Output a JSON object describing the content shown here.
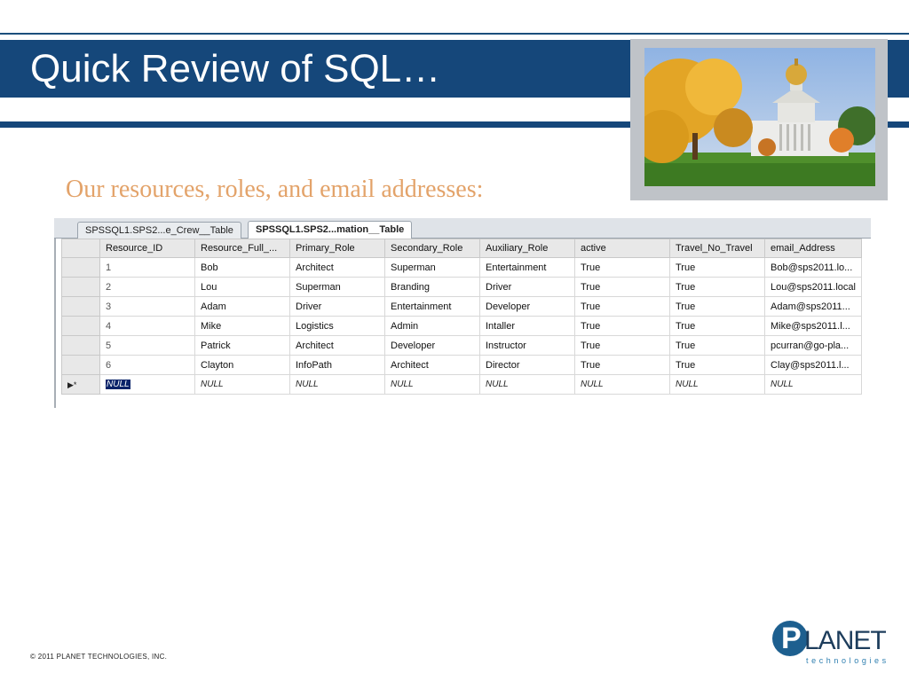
{
  "slide": {
    "title": "Quick Review of SQL…",
    "subtitle": "Our resources, roles, and email addresses:",
    "copyright": "©  2011  PLANET  TECHNOLOGIES,  INC."
  },
  "logo": {
    "letter": "P",
    "word": "LANET",
    "sub": "technologies"
  },
  "grid": {
    "tabs": [
      {
        "label": "SPSSQL1.SPS2...e_Crew__Table",
        "active": false
      },
      {
        "label": "SPSSQL1.SPS2...mation__Table",
        "active": true
      }
    ],
    "columns": [
      "Resource_ID",
      "Resource_Full_...",
      "Primary_Role",
      "Secondary_Role",
      "Auxiliary_Role",
      "active",
      "Travel_No_Travel",
      "email_Address"
    ],
    "rows": [
      [
        "1",
        "Bob",
        "Architect",
        "Superman",
        "Entertainment",
        "True",
        "True",
        "Bob@sps2011.lo..."
      ],
      [
        "2",
        "Lou",
        "Superman",
        "Branding",
        "Driver",
        "True",
        "True",
        "Lou@sps2011.local"
      ],
      [
        "3",
        "Adam",
        "Driver",
        "Entertainment",
        "Developer",
        "True",
        "True",
        "Adam@sps2011..."
      ],
      [
        "4",
        "Mike",
        "Logistics",
        "Admin",
        "Intaller",
        "True",
        "True",
        "Mike@sps2011.l..."
      ],
      [
        "5",
        "Patrick",
        "Architect",
        "Developer",
        "Instructor",
        "True",
        "True",
        "pcurran@go-pla..."
      ],
      [
        "6",
        "Clayton",
        "InfoPath",
        "Architect",
        "Director",
        "True",
        "True",
        "Clay@sps2011.l..."
      ]
    ],
    "new_row": [
      "NULL",
      "NULL",
      "NULL",
      "NULL",
      "NULL",
      "NULL",
      "NULL",
      "NULL"
    ],
    "new_row_marker": "▶*"
  }
}
